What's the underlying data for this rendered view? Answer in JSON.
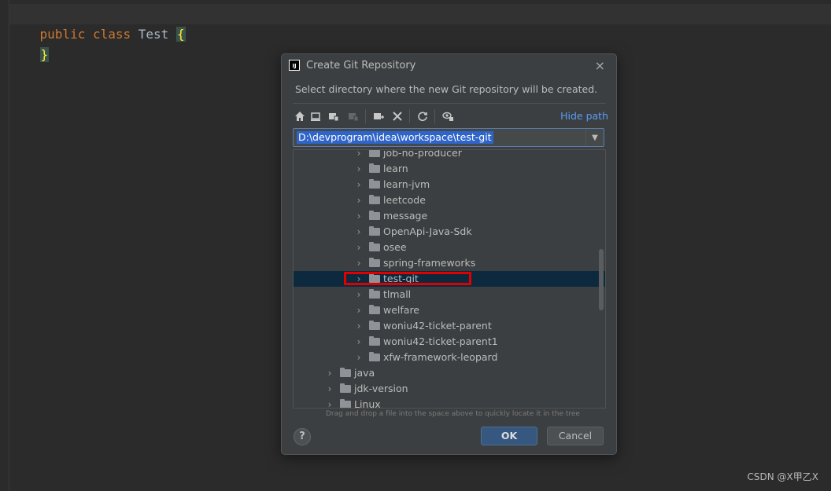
{
  "editor": {
    "line1": {
      "kw1": "public",
      "kw2": "class",
      "name": "Test",
      "brace": "{"
    },
    "line2": {
      "brace": "}"
    }
  },
  "watermark": "CSDN @X甲乙X",
  "dialog": {
    "title": "Create Git Repository",
    "app_icon": "IJ",
    "close_icon": "×",
    "description": "Select directory where the new Git repository will be created.",
    "hide_path": "Hide path",
    "path_value": "D:\\devprogram\\idea\\workspace\\test-git",
    "combo_arrow": "▼",
    "toolbar_icons": [
      "home-icon",
      "desktop-icon",
      "project-icon",
      "module-icon",
      "new-folder-icon",
      "delete-icon",
      "refresh-icon",
      "show-hidden-icon"
    ],
    "tree": [
      {
        "label": "job-no-producer",
        "level": 2
      },
      {
        "label": "learn",
        "level": 2
      },
      {
        "label": "learn-jvm",
        "level": 2
      },
      {
        "label": "leetcode",
        "level": 2
      },
      {
        "label": "message",
        "level": 2
      },
      {
        "label": "OpenApi-Java-Sdk",
        "level": 2
      },
      {
        "label": "osee",
        "level": 2
      },
      {
        "label": "spring-frameworks",
        "level": 2
      },
      {
        "label": "test-git",
        "level": 2,
        "selected": true
      },
      {
        "label": "tlmall",
        "level": 2
      },
      {
        "label": "welfare",
        "level": 2
      },
      {
        "label": "woniu42-ticket-parent",
        "level": 2
      },
      {
        "label": "woniu42-ticket-parent1",
        "level": 2
      },
      {
        "label": "xfw-framework-leopard",
        "level": 2
      },
      {
        "label": "java",
        "level": 1
      },
      {
        "label": "jdk-version",
        "level": 1
      },
      {
        "label": "Linux",
        "level": 1
      }
    ],
    "hint": "Drag and drop a file into the space above to quickly locate it in the tree",
    "help_label": "?",
    "ok_label": "OK",
    "cancel_label": "Cancel",
    "colors": {
      "accent": "#589df6",
      "selection": "#0d293e",
      "highlight_box": "#e00000",
      "ok_bg": "#365880"
    }
  }
}
